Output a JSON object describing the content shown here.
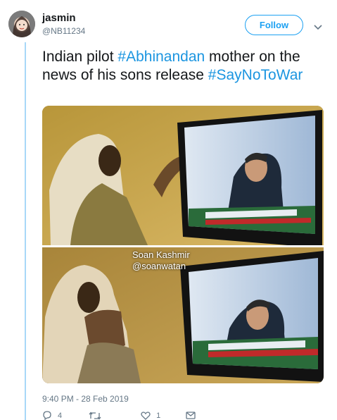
{
  "user": {
    "display_name": "jasmin",
    "handle": "@NB11234",
    "avatar_icon": "user-avatar"
  },
  "follow_label": "Follow",
  "tweet": {
    "text_1": "Indian pilot ",
    "hashtag_1": "#Abhinandan",
    "text_2": " mother on the news of his sons release ",
    "hashtag_2": "#SayNoToWar"
  },
  "media": {
    "watermark_line_1": "Soan Kashmir",
    "watermark_line_2": "@soanwatan"
  },
  "timestamp": "9:40 PM - 28 Feb 2019",
  "actions": {
    "reply_count": "4",
    "retweet_count": "",
    "like_count": "1"
  },
  "colors": {
    "accent": "#1da1f2",
    "hashtag": "#1b95e0",
    "muted": "#657786",
    "thread_line": "#a8d8f8"
  }
}
